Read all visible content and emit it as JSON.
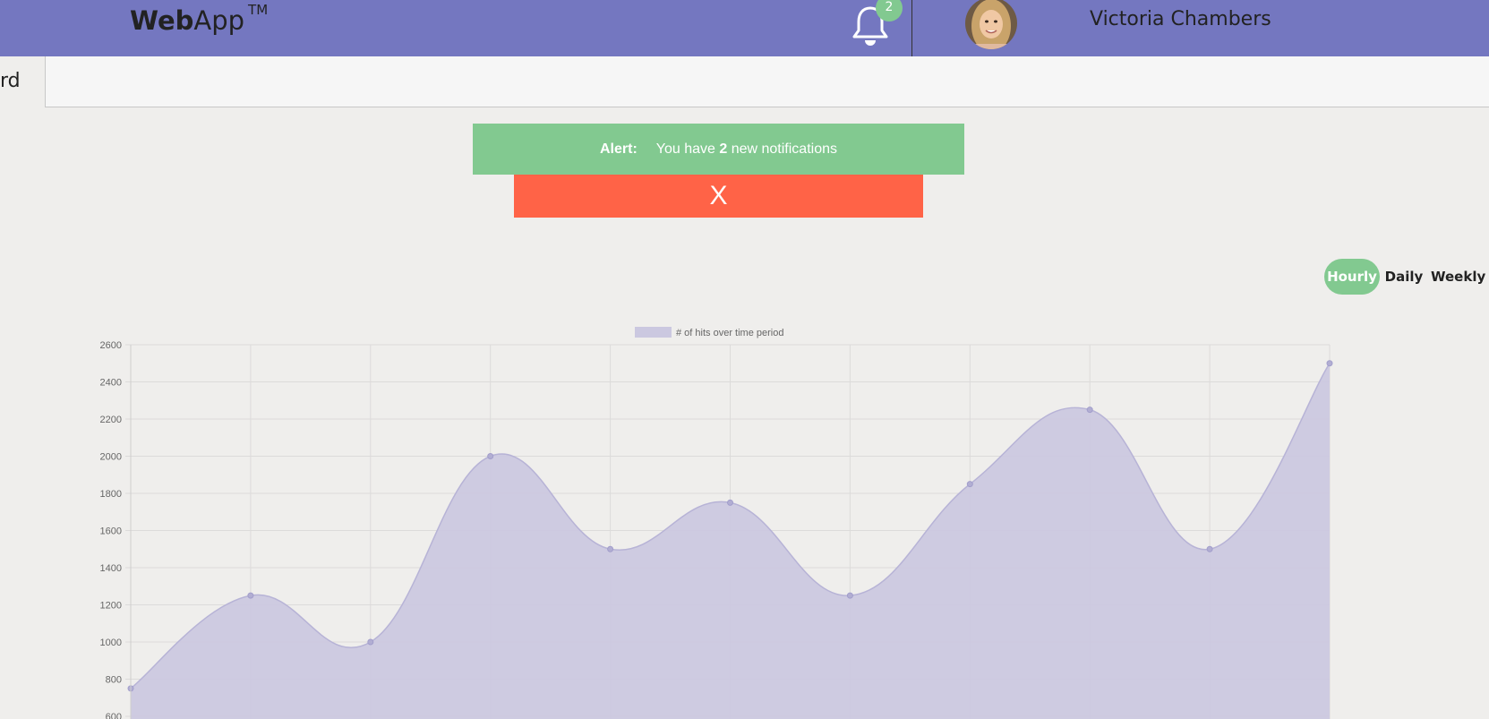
{
  "header": {
    "logo_bold": "Web",
    "logo_light": "App",
    "logo_tm": "TM",
    "notification_count": "2",
    "user_name": "Victoria Chambers"
  },
  "subnav": {
    "partial_label": "rd"
  },
  "alert": {
    "label": "Alert:",
    "prefix": "You have ",
    "count": "2",
    "suffix": " new notifications",
    "close_label": "X"
  },
  "periods": {
    "hourly": "Hourly",
    "daily": "Daily",
    "weekly": "Weekly",
    "active": "Hourly"
  },
  "colors": {
    "header": "#7477c0",
    "accent_green": "#82c990",
    "alert_close": "#ff6347",
    "chart_fill": "#cbc8e0"
  },
  "chart_data": {
    "type": "area",
    "legend": "# of hits over time period",
    "legend_position": "top-center",
    "grid": true,
    "y_ticks": [
      "2600",
      "2400",
      "2200",
      "2000",
      "1800",
      "1600",
      "1400",
      "1200",
      "1000",
      "800",
      "600"
    ],
    "ylim": [
      600,
      2600
    ],
    "series": [
      {
        "name": "# of hits over time period",
        "values": [
          750,
          1250,
          1000,
          2000,
          1500,
          1750,
          1250,
          1850,
          2250,
          1500,
          2500
        ]
      }
    ]
  }
}
